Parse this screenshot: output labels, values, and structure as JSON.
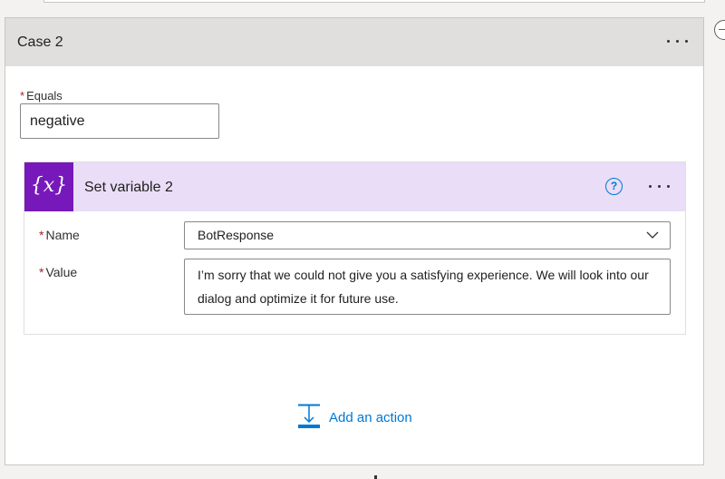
{
  "case": {
    "title": "Case 2",
    "more_label": "More options",
    "equals": {
      "required": "*",
      "label": "Equals",
      "value": "negative"
    },
    "action": {
      "icon_name": "variable-icon",
      "icon_glyph": "{x}",
      "title": "Set variable 2",
      "help_glyph": "?",
      "name_field": {
        "required": "*",
        "label": "Name",
        "value": "BotResponse"
      },
      "value_field": {
        "required": "*",
        "label": "Value",
        "value": "I’m sorry that we could not give you a satisfying experience. We will look into our dialog and optimize it for future use."
      }
    },
    "add_action_label": "Add an action"
  },
  "colors": {
    "accent": "#0078d4",
    "variable_brand": "#7719ba",
    "action_header_bg": "#e9ddf7",
    "case_header_bg": "#e1dfdd",
    "required": "#a4262c"
  }
}
